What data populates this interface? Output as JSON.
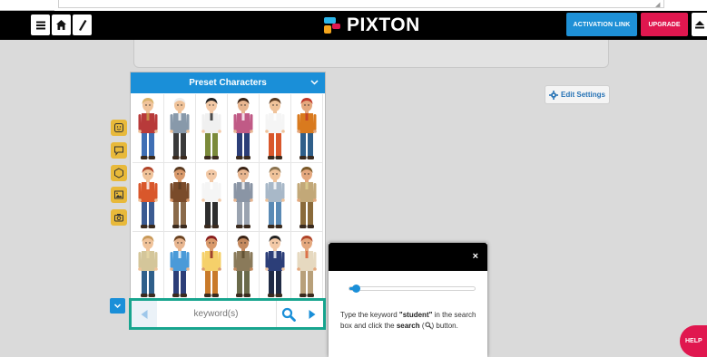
{
  "app": {
    "brand": "PIXTON",
    "colors": {
      "accent_blue": "#1a8fd8",
      "brand_pink": "#e0174f",
      "tool_yellow": "#e8b93a",
      "highlight_teal": "#18a58f"
    }
  },
  "topbar": {
    "menu_icon": "hamburger-icon",
    "home_icon": "home-icon",
    "edit_icon": "slash-icon",
    "activation_label": "ACTIVATION LINK",
    "upgrade_label": "UPGRADE",
    "eject_icon": "eject-icon"
  },
  "picker": {
    "header_label": "Preset Characters",
    "characters": [
      {
        "skin": "#f0c39a",
        "hair": "#d9b36b",
        "top": "#b83a3a",
        "bottom": "#3f6fb5",
        "accent": "#c9a04a"
      },
      {
        "skin": "#f0c39a",
        "hair": "#eeeeee",
        "top": "#8899aa",
        "bottom": "#3a3a3a",
        "accent": "#ffffff"
      },
      {
        "skin": "#f3c9a6",
        "hair": "#222222",
        "top": "#f0f0f0",
        "bottom": "#7b8a3a",
        "accent": "#222222"
      },
      {
        "skin": "#e8b690",
        "hair": "#3b2416",
        "top": "#c05a86",
        "bottom": "#2c3e78",
        "accent": "#ffffff"
      },
      {
        "skin": "#f0c39a",
        "hair": "#5a3b22",
        "top": "#f5f5f5",
        "bottom": "#d9572b",
        "accent": "#ffffff"
      },
      {
        "skin": "#e4a87e",
        "hair": "#c0392b",
        "top": "#d97a1e",
        "bottom": "#2f5f8a",
        "accent": "#c0392b"
      },
      {
        "skin": "#f0c39a",
        "hair": "#b0452a",
        "top": "#d9572b",
        "bottom": "#3b5b92",
        "accent": "#ffffff"
      },
      {
        "skin": "#d99a6c",
        "hair": "#5a3b22",
        "top": "#7a4b2a",
        "bottom": "#8a6a4a",
        "accent": "#5a3b22"
      },
      {
        "skin": "#f3c9a6",
        "hair": "#ffffff",
        "top": "#f5f5f5",
        "bottom": "#2d2d2d",
        "accent": "#ffffff"
      },
      {
        "skin": "#e8b690",
        "hair": "#3b2416",
        "top": "#8a95a5",
        "bottom": "#9aa3b0",
        "accent": "#ffffff"
      },
      {
        "skin": "#f0c39a",
        "hair": "#8a7350",
        "top": "#a8b8c8",
        "bottom": "#5a8ab5",
        "accent": "#ffffff"
      },
      {
        "skin": "#e4a87e",
        "hair": "#7a5a2a",
        "top": "#c2a878",
        "bottom": "#8a6a3a",
        "accent": "#e0cf90"
      },
      {
        "skin": "#f0c39a",
        "hair": "#c99a5a",
        "top": "#d4c69a",
        "bottom": "#2f5f8a",
        "accent": "#e6d7a5"
      },
      {
        "skin": "#e8b690",
        "hair": "#6b4423",
        "top": "#4a9ad8",
        "bottom": "#2c3e78",
        "accent": "#ffffff"
      },
      {
        "skin": "#d99a6c",
        "hair": "#8a1f1f",
        "top": "#f5d06a",
        "bottom": "#c97a2a",
        "accent": "#8a1f1f"
      },
      {
        "skin": "#c48a5f",
        "hair": "#3b2416",
        "top": "#8a7a5a",
        "bottom": "#6a6a4a",
        "accent": "#5a4a2a"
      },
      {
        "skin": "#f3c9a6",
        "hair": "#222222",
        "top": "#2c3e78",
        "bottom": "#1f2a44",
        "accent": "#ffffff"
      },
      {
        "skin": "#e4a87e",
        "hair": "#b0452a",
        "top": "#e6d9c0",
        "bottom": "#b8a07a",
        "accent": "#d9572b"
      }
    ]
  },
  "tools": [
    {
      "name": "face-tool",
      "icon": "smiley-icon"
    },
    {
      "name": "speech-tool",
      "icon": "speech-bubble-icon"
    },
    {
      "name": "prop-tool",
      "icon": "hexagon-icon"
    },
    {
      "name": "scene-tool",
      "icon": "image-icon"
    },
    {
      "name": "photo-tool",
      "icon": "camera-icon"
    }
  ],
  "search": {
    "placeholder": "keyword(s)",
    "value": "",
    "prev_icon": "arrow-left-icon",
    "search_icon": "search-icon",
    "next_icon": "arrow-right-icon"
  },
  "settings": {
    "label": "Edit Settings",
    "icon": "gear-icon"
  },
  "tutorial": {
    "close_label": "×",
    "progress_fraction": 0.05,
    "text_1": "Type the keyword ",
    "keyword": "\"student\"",
    "text_2": " in the search box and click the ",
    "search_word": "search",
    "text_3": " (",
    "text_4": ") button."
  },
  "help": {
    "label": "HELP"
  }
}
